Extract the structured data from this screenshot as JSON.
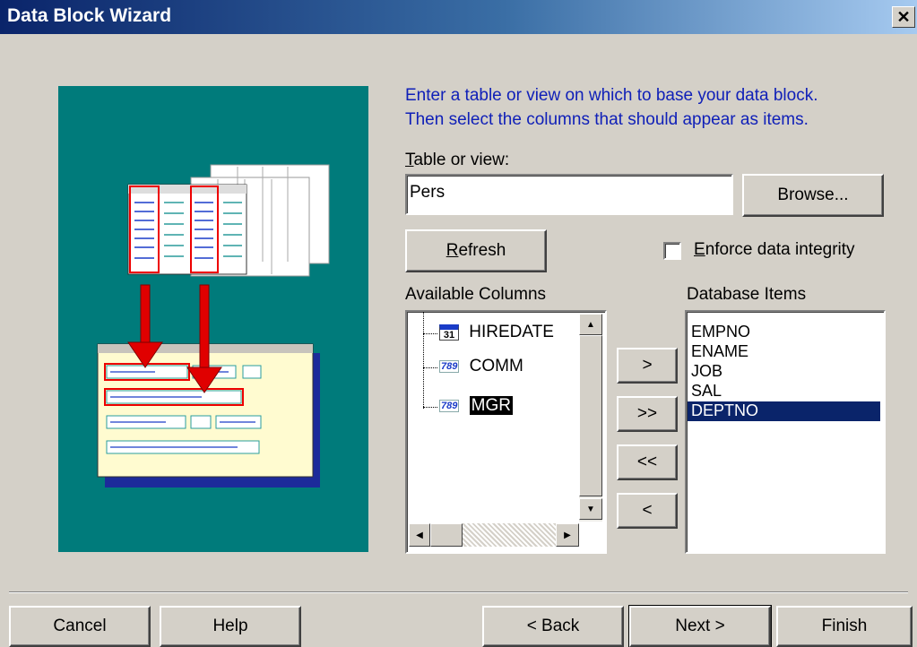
{
  "window": {
    "title": "Data Block Wizard",
    "close_glyph": "✕"
  },
  "instructions": {
    "line1": "Enter a table or view on which to base your data block.",
    "line2": "Then select the columns that should appear as items."
  },
  "table": {
    "label_mnemonic": "T",
    "label_rest": "able or view:",
    "value": "Pers",
    "browse_label": "Browse..."
  },
  "refresh": {
    "mnemonic": "R",
    "rest": "efresh"
  },
  "enforce": {
    "mnemonic": "E",
    "rest": "nforce data integrity",
    "checked": false
  },
  "available": {
    "heading": "Available Columns",
    "items": [
      {
        "label": "HIREDATE",
        "icon": "calendar-icon",
        "icon_text": "31"
      },
      {
        "label": "COMM",
        "icon": "number-icon",
        "icon_text": "789"
      },
      {
        "label": "MGR",
        "icon": "number-icon",
        "icon_text": "789",
        "selected": true
      }
    ]
  },
  "database": {
    "heading": "Database Items",
    "items": [
      "EMPNO",
      "ENAME",
      "JOB",
      "SAL",
      "DEPTNO"
    ],
    "selected": "DEPTNO"
  },
  "movers": {
    "add": ">",
    "add_all": ">>",
    "remove_all": "<<",
    "remove": "<"
  },
  "footer": {
    "cancel": "Cancel",
    "help": "Help",
    "back": "< Back",
    "next": "Next >",
    "finish": "Finish"
  },
  "colors": {
    "illustration_bg": "#007b7b",
    "selection": "#0a246a",
    "instruction_text": "#1020b8"
  }
}
